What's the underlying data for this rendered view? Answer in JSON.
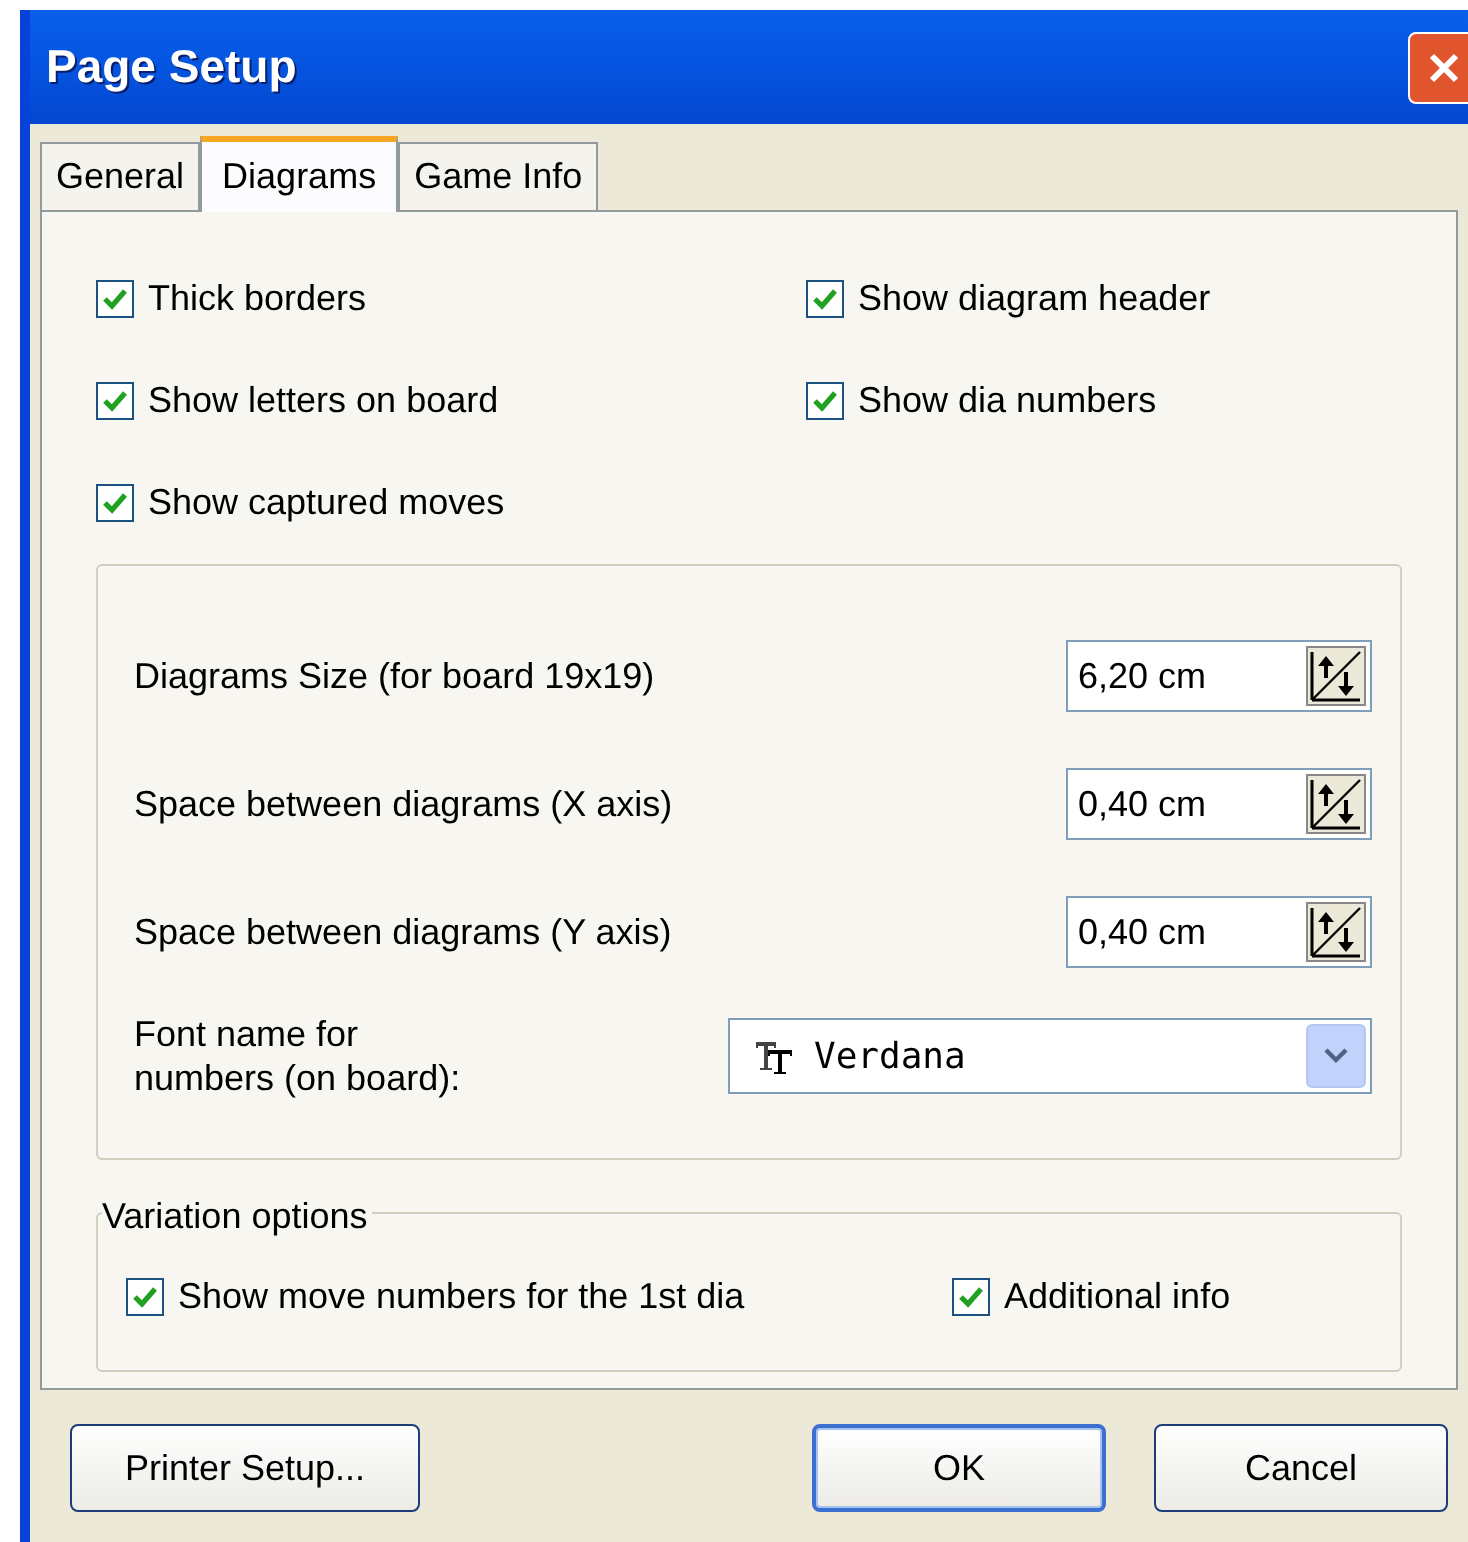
{
  "window": {
    "title": "Page Setup"
  },
  "tabs": [
    {
      "label": "General",
      "selected": false
    },
    {
      "label": "Diagrams",
      "selected": true
    },
    {
      "label": "Game Info",
      "selected": false
    }
  ],
  "options_left": [
    {
      "label": "Thick borders",
      "checked": true
    },
    {
      "label": "Show letters on board",
      "checked": true
    },
    {
      "label": "Show captured moves",
      "checked": true
    }
  ],
  "options_right": [
    {
      "label": "Show diagram header",
      "checked": true
    },
    {
      "label": "Show dia numbers",
      "checked": true
    }
  ],
  "size_settings": [
    {
      "label": "Diagrams Size (for board 19x19)",
      "value": "6,20 cm"
    },
    {
      "label": "Space between diagrams (X axis)",
      "value": "0,40 cm"
    },
    {
      "label": "Space between diagrams (Y axis)",
      "value": "0,40 cm"
    }
  ],
  "font_setting": {
    "label": "Font name for numbers (on board):",
    "value": "Verdana"
  },
  "variation_options": {
    "title": "Variation options",
    "options": [
      {
        "label": "Show move numbers for the 1st dia",
        "checked": true
      },
      {
        "label": "Additional info",
        "checked": true
      }
    ]
  },
  "buttons": [
    {
      "label": "Printer Setup...",
      "default": false
    },
    {
      "label": "OK",
      "default": true
    },
    {
      "label": "Cancel",
      "default": false
    }
  ]
}
